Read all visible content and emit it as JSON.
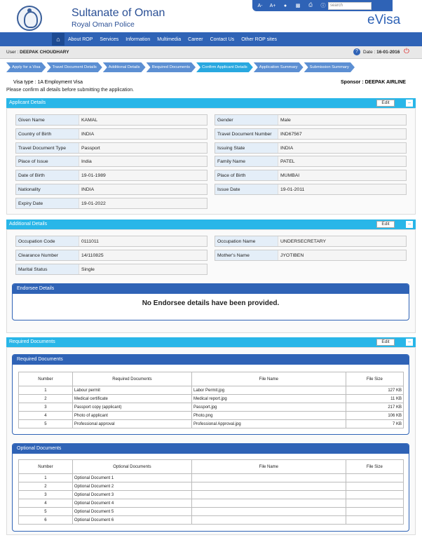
{
  "header": {
    "title": "Sultanate of Oman",
    "subtitle": "Royal Oman Police",
    "evisa": "eVisa",
    "search_placeholder": "search",
    "tools": [
      "A-",
      "A+",
      "user-icon",
      "sitemap-icon",
      "print-icon",
      "info-icon"
    ]
  },
  "nav": {
    "items": [
      "About ROP",
      "Services",
      "Information",
      "Multimedia",
      "Career",
      "Contact Us",
      "Other ROP sites"
    ]
  },
  "userbar": {
    "user_label": "User : ",
    "user": "DEEPAK CHOUDHARY",
    "date_label": "Date : ",
    "date": "16-01-2016"
  },
  "steps": [
    "Apply for a Visa",
    "Travel Document Details",
    "Additional Details",
    "Required Documents",
    "Confirm Applicant Details",
    "Application Summary",
    "Submission Summary"
  ],
  "visa": {
    "type_label": "Visa type : ",
    "type": "1A Employment Visa",
    "sponsor_label": "Sponsor : ",
    "sponsor": "DEEPAK AIRLINE",
    "confirm": "Please confirm all details before submitting the application."
  },
  "applicant": {
    "title": "Applicant Details",
    "edit": "Edit",
    "left": [
      [
        "Given Name",
        "KAMAL"
      ],
      [
        "Country of Birth",
        "INDIA"
      ],
      [
        "Travel Document Type",
        "Passport"
      ],
      [
        "Place of Issue",
        "India"
      ],
      [
        "Date of Birth",
        "19-01-1989"
      ],
      [
        "Nationality",
        "INDIA"
      ],
      [
        "Expiry Date",
        "19-01-2022"
      ]
    ],
    "right": [
      [
        "Gender",
        "Male"
      ],
      [
        "Travel Document Number",
        "IND67567"
      ],
      [
        "Issuing State",
        "INDIA"
      ],
      [
        "Family Name",
        "PATEL"
      ],
      [
        "Place of Birth",
        "MUMBAI"
      ],
      [
        "Issue Date",
        "19-01-2011"
      ]
    ]
  },
  "additional": {
    "title": "Additional Details",
    "edit": "Edit",
    "left": [
      [
        "Occupation Code",
        "0111011"
      ],
      [
        "Clearance Number",
        "14/110825"
      ],
      [
        "Marital Status",
        "Single"
      ]
    ],
    "right": [
      [
        "Occupation Name",
        "UNDERSECRETARY"
      ],
      [
        "Mother's Name",
        "JYOTIBEN"
      ]
    ]
  },
  "endorsee": {
    "title": "Endorsee Details",
    "message": "No Endorsee details have been provided."
  },
  "reqdocs": {
    "title": "Required Documents",
    "edit": "Edit",
    "panel_title": "Required Documents",
    "headers": [
      "Number",
      "Required Documents",
      "File Name",
      "File Size"
    ],
    "rows": [
      [
        "1",
        "Labour permit",
        "Labor Permit.jpg",
        "127 KB"
      ],
      [
        "2",
        "Medical certificate",
        "Medical report.jpg",
        "11 KB"
      ],
      [
        "3",
        "Passport copy (applicant)",
        "Passport.jpg",
        "217 KB"
      ],
      [
        "4",
        "Photo of applicant",
        "Photo.png",
        "106 KB"
      ],
      [
        "5",
        "Professional approval",
        "Professional Approval.jpg",
        "7 KB"
      ]
    ]
  },
  "optdocs": {
    "panel_title": "Optional Documents",
    "headers": [
      "Number",
      "Optional Documents",
      "File Name",
      "File Size"
    ],
    "rows": [
      [
        "1",
        "Optional Document 1",
        "",
        ""
      ],
      [
        "2",
        "Optional Document 2",
        "",
        ""
      ],
      [
        "3",
        "Optional Document 3",
        "",
        ""
      ],
      [
        "4",
        "Optional Document 4",
        "",
        ""
      ],
      [
        "5",
        "Optional Document 5",
        "",
        ""
      ],
      [
        "6",
        "Optional Document 6",
        "",
        ""
      ]
    ]
  }
}
